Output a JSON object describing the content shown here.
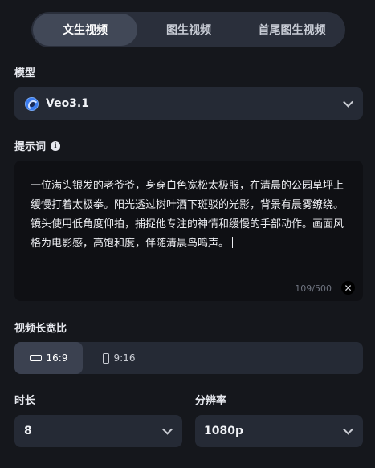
{
  "mode_tabs": [
    {
      "label": "文生视频",
      "active": true
    },
    {
      "label": "图生视频",
      "active": false
    },
    {
      "label": "首尾图生视频",
      "active": false
    }
  ],
  "model": {
    "label": "模型",
    "value": "Veo3.1",
    "icon": "veo-logo-icon"
  },
  "prompt": {
    "label": "提示词",
    "info_icon": "i",
    "text": "一位满头银发的老爷爷，身穿白色宽松太极服，在清晨的公园草坪上缓慢打着太极拳。阳光透过树叶洒下斑驳的光影，背景有晨雾缭绕。镜头使用低角度仰拍，捕捉他专注的神情和缓慢的手部动作。画面风格为电影感，高饱和度，伴随清晨鸟鸣声。",
    "counter": "109/500",
    "clear_symbol": "✕"
  },
  "aspect_ratio": {
    "label": "视频长宽比",
    "options": [
      {
        "label": "16:9",
        "active": true
      },
      {
        "label": "9:16",
        "active": false
      }
    ]
  },
  "duration": {
    "label": "时长",
    "value": "8"
  },
  "resolution": {
    "label": "分辨率",
    "value": "1080p"
  },
  "colors": {
    "background": "#15171c",
    "surface": "#252a35",
    "active_tab": "#414857",
    "prompt_bg": "#0f1014"
  }
}
